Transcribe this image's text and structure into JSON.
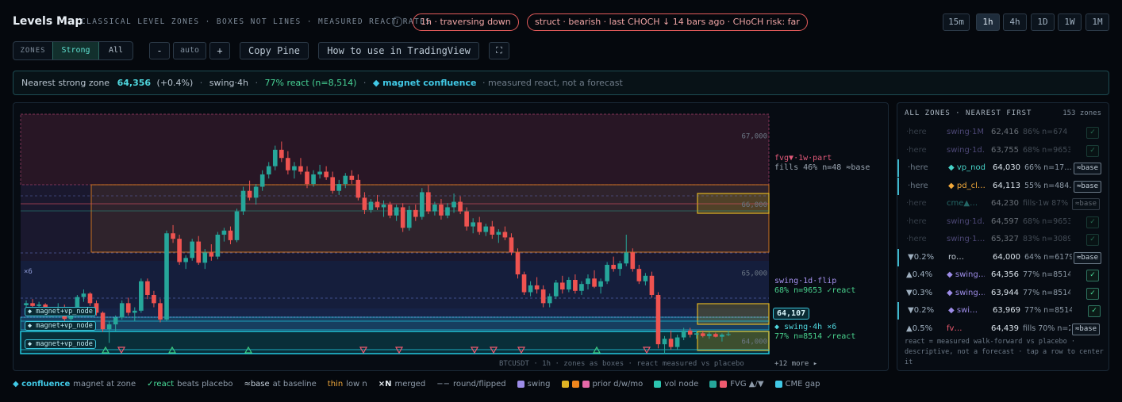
{
  "header": {
    "title": "Levels Map",
    "subtitle": "CLASSICAL LEVEL ZONES · BOXES NOT LINES · MEASURED REACT RATES",
    "info_icon": "i",
    "pill_traversal": "1h · traversing down",
    "pill_struct": "struct · bearish · last CHOCH ↓ 14 bars ago · CHoCH risk: far",
    "timeframes": [
      "15m",
      "1h",
      "4h",
      "1D",
      "1W",
      "1M"
    ],
    "active_timeframe": "1h"
  },
  "toolbar": {
    "zones_label": "ZONES",
    "strong_label": "Strong",
    "all_label": "All",
    "minus": "-",
    "zoom": "auto",
    "plus": "+",
    "copy_pine": "Copy Pine",
    "how_to": "How to use in TradingView",
    "fullscreen_icon": "⛶"
  },
  "infobar": {
    "label": "Nearest strong zone",
    "price": "64,356",
    "change": "(+0.4%)",
    "sep": "·",
    "source": "swing·4h",
    "react": "77% react (n=8,514)",
    "confluence": "◆ magnet confluence",
    "note": "· measured react, not a forecast"
  },
  "chart": {
    "price_labels": [
      "67,000",
      "66,000",
      "65,000",
      "64,000"
    ],
    "current_price": "64,107",
    "zone_label_fvg": "fvg▼·1w·part",
    "zone_stat_fvg": "fills 46% n=48 ≈base",
    "zone_label_swing1d": "swing·1d·flip",
    "zone_stat_swing1d": "68% n=9653 ✓react",
    "zone_label_swing4h": "◆ swing·4h ×6",
    "zone_stat_swing4h": "77% n=8514 ✓react",
    "magnet_tags": [
      "◆ magnet+vp_node",
      "◆ magnet+vp_node",
      "◆ magnet+vp_node"
    ],
    "merge_tag": "×6",
    "footer": "BTCUSDT · 1h · zones as boxes · react measured vs placebo",
    "more_link": "+12 more ▸",
    "colors": {
      "up": "#26a69a",
      "down": "#ef5350",
      "accent": "#40d0e0"
    }
  },
  "chart_data": {
    "type": "candlestick",
    "symbol": "BTCUSDT",
    "interval": "1h",
    "ylim": [
      63800,
      67250
    ],
    "y_ticks": [
      67000,
      66000,
      65000,
      64000
    ],
    "candles": [
      [
        64530,
        64600,
        64450,
        64560
      ],
      [
        64560,
        64620,
        64500,
        64520
      ],
      [
        64520,
        64580,
        64460,
        64540
      ],
      [
        64540,
        64560,
        64380,
        64420
      ],
      [
        64420,
        64500,
        64350,
        64480
      ],
      [
        64480,
        64560,
        64420,
        64500
      ],
      [
        64500,
        64540,
        64300,
        64330
      ],
      [
        64330,
        64420,
        64280,
        64390
      ],
      [
        64390,
        64680,
        64370,
        64650
      ],
      [
        64650,
        64760,
        64580,
        64700
      ],
      [
        64700,
        64720,
        64520,
        64560
      ],
      [
        64560,
        64600,
        64380,
        64420
      ],
      [
        64420,
        64440,
        64140,
        64180
      ],
      [
        64180,
        64300,
        63980,
        64250
      ],
      [
        64250,
        64380,
        64150,
        64350
      ],
      [
        64350,
        64600,
        64320,
        64560
      ],
      [
        64560,
        64640,
        64380,
        64420
      ],
      [
        64420,
        64500,
        64300,
        64450
      ],
      [
        64450,
        64920,
        64420,
        64880
      ],
      [
        64880,
        64920,
        64620,
        64680
      ],
      [
        64680,
        64740,
        64500,
        64560
      ],
      [
        64560,
        64620,
        64280,
        64320
      ],
      [
        64320,
        65620,
        64300,
        65580
      ],
      [
        65580,
        65700,
        65440,
        65500
      ],
      [
        65500,
        65560,
        65120,
        65160
      ],
      [
        65160,
        65260,
        65060,
        65220
      ],
      [
        65220,
        65500,
        65180,
        65460
      ],
      [
        65460,
        65540,
        65120,
        65150
      ],
      [
        65150,
        65350,
        65060,
        65300
      ],
      [
        65300,
        65420,
        65180,
        65240
      ],
      [
        65240,
        65600,
        65200,
        65560
      ],
      [
        65560,
        65660,
        65460,
        65620
      ],
      [
        65620,
        65680,
        65420,
        65480
      ],
      [
        65480,
        65940,
        65450,
        65900
      ],
      [
        65900,
        66260,
        65850,
        66200
      ],
      [
        66200,
        66350,
        66060,
        66100
      ],
      [
        66100,
        66300,
        66000,
        66260
      ],
      [
        66260,
        66500,
        66200,
        66440
      ],
      [
        66440,
        66620,
        66380,
        66560
      ],
      [
        66560,
        66860,
        66500,
        66800
      ],
      [
        66800,
        66920,
        66620,
        66680
      ],
      [
        66680,
        66780,
        66440,
        66500
      ],
      [
        66500,
        66620,
        66380,
        66560
      ],
      [
        66560,
        66680,
        66440,
        66480
      ],
      [
        66480,
        66560,
        66240,
        66300
      ],
      [
        66300,
        66500,
        66260,
        66440
      ],
      [
        66440,
        66580,
        66380,
        66480
      ],
      [
        66480,
        66560,
        66360,
        66400
      ],
      [
        66400,
        66480,
        66160,
        66200
      ],
      [
        66200,
        66360,
        66140,
        66300
      ],
      [
        66300,
        66460,
        66240,
        66420
      ],
      [
        66420,
        66500,
        66300,
        66360
      ],
      [
        66360,
        66440,
        66060,
        66100
      ],
      [
        66100,
        66180,
        65860,
        65920
      ],
      [
        65920,
        66080,
        65880,
        66040
      ],
      [
        66040,
        66140,
        65920,
        65960
      ],
      [
        65960,
        66060,
        65820,
        66000
      ],
      [
        66000,
        66040,
        65800,
        65840
      ],
      [
        65840,
        66000,
        65760,
        65960
      ],
      [
        65960,
        66020,
        65600,
        65660
      ],
      [
        65660,
        65980,
        65620,
        65920
      ],
      [
        65920,
        66000,
        65760,
        65820
      ],
      [
        65820,
        66240,
        65780,
        66180
      ],
      [
        66180,
        66280,
        65860,
        65900
      ],
      [
        65900,
        66040,
        65840,
        66000
      ],
      [
        66000,
        66080,
        65780,
        65840
      ],
      [
        65840,
        66020,
        65800,
        65960
      ],
      [
        65960,
        66160,
        65880,
        66040
      ],
      [
        66040,
        66120,
        65860,
        65900
      ],
      [
        65900,
        65960,
        65620,
        65680
      ],
      [
        65680,
        65800,
        65580,
        65740
      ],
      [
        65740,
        65820,
        65560,
        65600
      ],
      [
        65600,
        65720,
        65540,
        65680
      ],
      [
        65680,
        65760,
        65500,
        65560
      ],
      [
        65560,
        65640,
        65440,
        65600
      ],
      [
        65600,
        65680,
        65480,
        65520
      ],
      [
        65520,
        65580,
        65260,
        65300
      ],
      [
        65300,
        65360,
        64920,
        64980
      ],
      [
        64980,
        65020,
        64680,
        64720
      ],
      [
        64720,
        64880,
        64660,
        64820
      ],
      [
        64820,
        64940,
        64700,
        64760
      ],
      [
        64760,
        64820,
        64500,
        64560
      ],
      [
        64560,
        64700,
        64500,
        64660
      ],
      [
        64660,
        64900,
        64620,
        64860
      ],
      [
        64860,
        64960,
        64700,
        64760
      ],
      [
        64760,
        64940,
        64720,
        64900
      ],
      [
        64900,
        64980,
        64700,
        64740
      ],
      [
        64740,
        64880,
        64680,
        64840
      ],
      [
        64840,
        64980,
        64760,
        64920
      ],
      [
        64920,
        65040,
        64780,
        64800
      ],
      [
        64800,
        64920,
        64700,
        64880
      ],
      [
        64880,
        65160,
        64840,
        65120
      ],
      [
        65120,
        65240,
        65020,
        65060
      ],
      [
        65060,
        65180,
        64960,
        65140
      ],
      [
        65140,
        65560,
        65100,
        65300
      ],
      [
        65300,
        65360,
        65020,
        65060
      ],
      [
        65060,
        65120,
        64840,
        64880
      ],
      [
        64880,
        65000,
        64820,
        64960
      ],
      [
        64960,
        65020,
        64640,
        64680
      ],
      [
        64680,
        64720,
        63900,
        63960
      ],
      [
        63960,
        64080,
        63820,
        64040
      ],
      [
        64040,
        64160,
        63880,
        63920
      ],
      [
        63920,
        64100,
        63880,
        64060
      ],
      [
        64060,
        64200,
        64020,
        64160
      ],
      [
        64160,
        64200,
        64060,
        64100
      ],
      [
        64100,
        64160,
        64040,
        64120
      ],
      [
        64120,
        64160,
        64060,
        64080
      ],
      [
        64080,
        64140,
        64040,
        64110
      ],
      [
        64110,
        64130,
        64060,
        64070
      ],
      [
        64070,
        64120,
        64000,
        64100
      ],
      [
        64100,
        64160,
        64080,
        64107
      ]
    ],
    "zones": [
      {
        "name": "fvg▼·1w·part",
        "from": 66050,
        "to": 67000,
        "color": "#c04a7a"
      },
      {
        "name": "prior d/w/mo",
        "from": 65030,
        "to": 66060,
        "color": "#f0861d"
      },
      {
        "name": "swing·1d·flip",
        "from": 64100,
        "to": 64990,
        "color": "#4a56b8"
      },
      {
        "name": "swing·4h ×6",
        "from": 63800,
        "to": 64060,
        "color": "#22c8e0"
      }
    ]
  },
  "zones_panel": {
    "title": "ALL ZONES · NEAREST FIRST",
    "count": "153 zones",
    "rows": [
      {
        "dist": "·here",
        "name": "swing·1M…",
        "price": "62,416",
        "stat": "86% n=674 ✓…",
        "action": "✓",
        "dim": true,
        "focus": false,
        "name_color": "#9d8ce8"
      },
      {
        "dist": "·here",
        "name": "swing·1d…",
        "price": "63,755",
        "stat": "68% n=9653 …",
        "action": "✓",
        "dim": true,
        "focus": false,
        "name_color": "#9d8ce8"
      },
      {
        "dist": "·here",
        "name": "◆ vp_nod…",
        "price": "64,030",
        "stat": "66% n=17…",
        "action": "≈base",
        "dim": false,
        "focus": true,
        "name_color": "#46d3c8"
      },
      {
        "dist": "·here",
        "name": "◆ pd_cl…",
        "price": "64,113",
        "stat": "55% n=484…",
        "action": "≈base",
        "dim": false,
        "focus": true,
        "name_color": "#f2a93b"
      },
      {
        "dist": "·here",
        "name": "cme▲…",
        "price": "64,230",
        "stat": "fills·1w 87% …",
        "action": "≈base",
        "dim": true,
        "focus": false,
        "name_color": "#46d3c8"
      },
      {
        "dist": "·here",
        "name": "swing·1d…",
        "price": "64,597",
        "stat": "68% n=9653 …",
        "action": "✓",
        "dim": true,
        "focus": false,
        "name_color": "#9d8ce8"
      },
      {
        "dist": "·here",
        "name": "swing·1…",
        "price": "65,327",
        "stat": "83% n=3089 …",
        "action": "✓",
        "dim": true,
        "focus": false,
        "name_color": "#9d8ce8"
      },
      {
        "dist": "▼0.2%",
        "name": "ro…",
        "price": "64,000",
        "stat": "64% n=6179 ≈…",
        "action": "≈base",
        "dim": false,
        "focus": true,
        "name_color": "#c9d3dd"
      },
      {
        "dist": "▲0.4%",
        "name": "◆ swing…",
        "price": "64,356",
        "stat": "77% n=8514 ✓…",
        "action": "✓",
        "dim": false,
        "focus": false,
        "name_color": "#9d8ce8"
      },
      {
        "dist": "▼0.3%",
        "name": "◆ swing…",
        "price": "63,944",
        "stat": "77% n=8514 ✓…",
        "action": "✓",
        "dim": false,
        "focus": false,
        "name_color": "#9d8ce8"
      },
      {
        "dist": "▼0.2%",
        "name": "◆ swi…",
        "price": "63,969",
        "stat": "77% n=8514 ✓re…",
        "action": "✓",
        "dim": false,
        "focus": true,
        "name_color": "#9d8ce8"
      },
      {
        "dist": "▲0.5%",
        "name": "fv…",
        "price": "64,439",
        "stat": "fills 70% n=278 …",
        "action": "≈base",
        "dim": false,
        "focus": false,
        "name_color": "#ef5a6f"
      }
    ],
    "footer": "react = measured walk-forward vs placebo · descriptive, not a forecast · tap a row to center it"
  },
  "legend": {
    "confluence_key": "◆ confluence",
    "confluence_text": "magnet at zone",
    "react_key": "✓react",
    "react_text": "beats placebo",
    "base_key": "≈base",
    "base_text": "at baseline",
    "thin_key": "thin",
    "thin_text": "low n",
    "merged_key": "×N",
    "merged_text": "merged",
    "round_key": "−−",
    "round_text": "round/flipped",
    "swing_text": "swing",
    "prior_text": "prior d/w/mo",
    "vol_text": "vol node",
    "fvg_text": "FVG ▲/▼",
    "cme_text": "CME gap"
  }
}
